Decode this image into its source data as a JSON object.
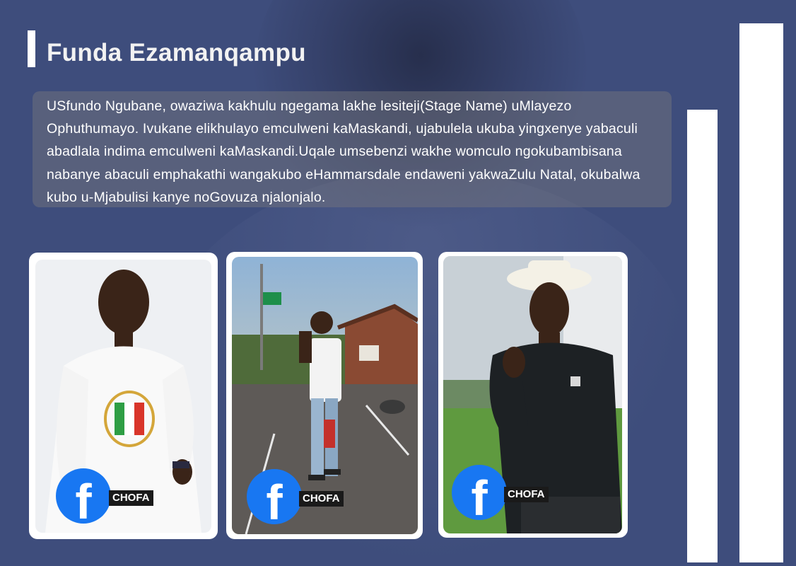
{
  "header": {
    "title": "Funda Ezamanqampu"
  },
  "bio": {
    "text": "USfundo Ngubane, owaziwa kakhulu ngegama lakhe lesiteji(Stage Name) uMlayezo Ophuthumayo. Ivukane elikhulayo emculweni kaMaskandi, ujabulela ukuba yingxenye yabaculi abadlala indima emculweni kaMaskandi.Uqale umsebenzi wakhe womculo ngokubambisana nabanye abaculi emphakathi wangakubo eHammarsdale endaweni yakwaZulu Natal, okubalwa kubo u-Mjabulisi kanye noGovuza njalonjalo."
  },
  "gallery": [
    {
      "tag": "CHOFA",
      "icon": "facebook-icon",
      "scene": "white-studio"
    },
    {
      "tag": "CHOFA",
      "icon": "facebook-icon",
      "scene": "outdoor-performance"
    },
    {
      "tag": "CHOFA",
      "icon": "facebook-icon",
      "scene": "hillside-performance"
    }
  ],
  "colors": {
    "background": "#3e4d7c",
    "accent_bars": "#ffffff",
    "facebook": "#1877f2"
  }
}
